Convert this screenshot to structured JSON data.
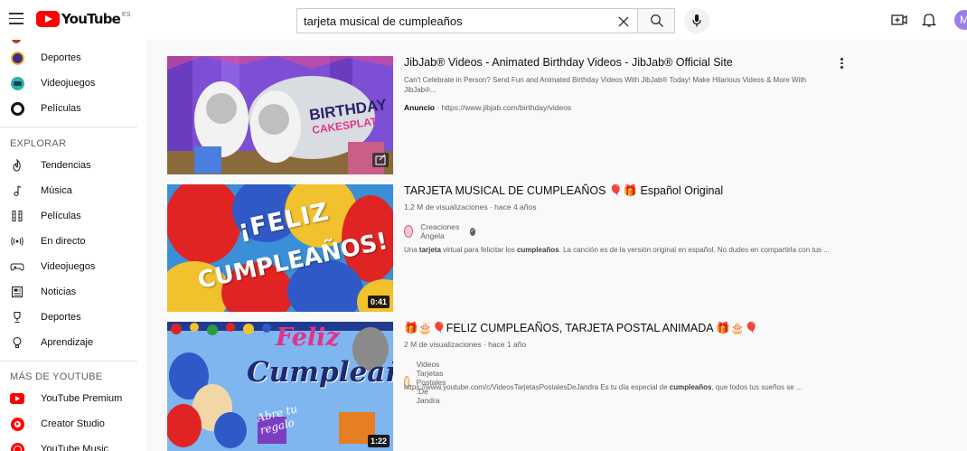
{
  "header": {
    "country": "ES",
    "logo_text": "YouTube",
    "search_value": "tarjeta musical de cumpleaños",
    "avatar_letter": "M"
  },
  "sidebar": {
    "top_items": [
      {
        "label": "Deportes",
        "icon": "sports-icon"
      },
      {
        "label": "Videojuegos",
        "icon": "gaming-icon"
      },
      {
        "label": "Películas",
        "icon": "movies-icon"
      }
    ],
    "explore_title": "EXPLORAR",
    "explore_items": [
      {
        "label": "Tendencias",
        "icon": "trending-icon"
      },
      {
        "label": "Música",
        "icon": "music-icon"
      },
      {
        "label": "Películas",
        "icon": "film-icon"
      },
      {
        "label": "En directo",
        "icon": "live-icon"
      },
      {
        "label": "Videojuegos",
        "icon": "gaming-icon"
      },
      {
        "label": "Noticias",
        "icon": "news-icon"
      },
      {
        "label": "Deportes",
        "icon": "trophy-icon"
      },
      {
        "label": "Aprendizaje",
        "icon": "learning-icon"
      }
    ],
    "more_title": "MÁS DE YOUTUBE",
    "more_items": [
      {
        "label": "YouTube Premium",
        "icon": "youtube-premium-icon"
      },
      {
        "label": "Creator Studio",
        "icon": "creator-studio-icon"
      },
      {
        "label": "YouTube Music",
        "icon": "youtube-music-icon"
      }
    ]
  },
  "results": [
    {
      "title": "JibJab® Videos - Animated Birthday Videos - JibJab® Official Site",
      "desc": "Can't Celebrate in Person? Send Fun and Animated Birthday Videos With JibJab® Today! Make Hilarious Videos & More With JibJab®...",
      "ad_label": "Anuncio",
      "ad_url": "· https://www.jibjab.com/birthday/videos",
      "thumb_text_1": "BIRTHDAY",
      "thumb_text_2": "CAKESPLAT"
    },
    {
      "title": "TARJETA MUSICAL DE CUMPLEAÑOS 🎈🎁 Español Original",
      "meta": "1,2 M de visualizaciones · hace 4 años",
      "channel": "Creaciones Ángela",
      "desc_pre": "Una ",
      "desc_b1": "tarjeta",
      "desc_mid": " virtual para felicitar los ",
      "desc_b2": "cumpleaños",
      "desc_post": ". La canción es de la versión original en español. No dudes en compartirla con tus ...",
      "duration": "0:41",
      "thumb_text_1": "¡FELIZ",
      "thumb_text_2": "CUMPLEAÑOS!"
    },
    {
      "title": "🎁🎂🎈FELIZ CUMPLEAÑOS, TARJETA POSTAL ANIMADA 🎁🎂🎈",
      "meta": "2 M de visualizaciones · hace 1 año",
      "channel": "Videos Tarjetas Postales :De Jandra",
      "desc_pre": "https://www.youtube.com/c/VideosTarjetasPostalesDeJandra Es tu día especial de ",
      "desc_b1": "cumpleaños",
      "desc_post": ", que todos tus sueños se ...",
      "duration": "1:22",
      "thumb_text_1": "Feliz",
      "thumb_text_2": "Cumpleaños",
      "thumb_text_3": "Abre tu regalo"
    }
  ],
  "colors": {
    "brand": "#ff0000",
    "text_secondary": "#606060"
  }
}
